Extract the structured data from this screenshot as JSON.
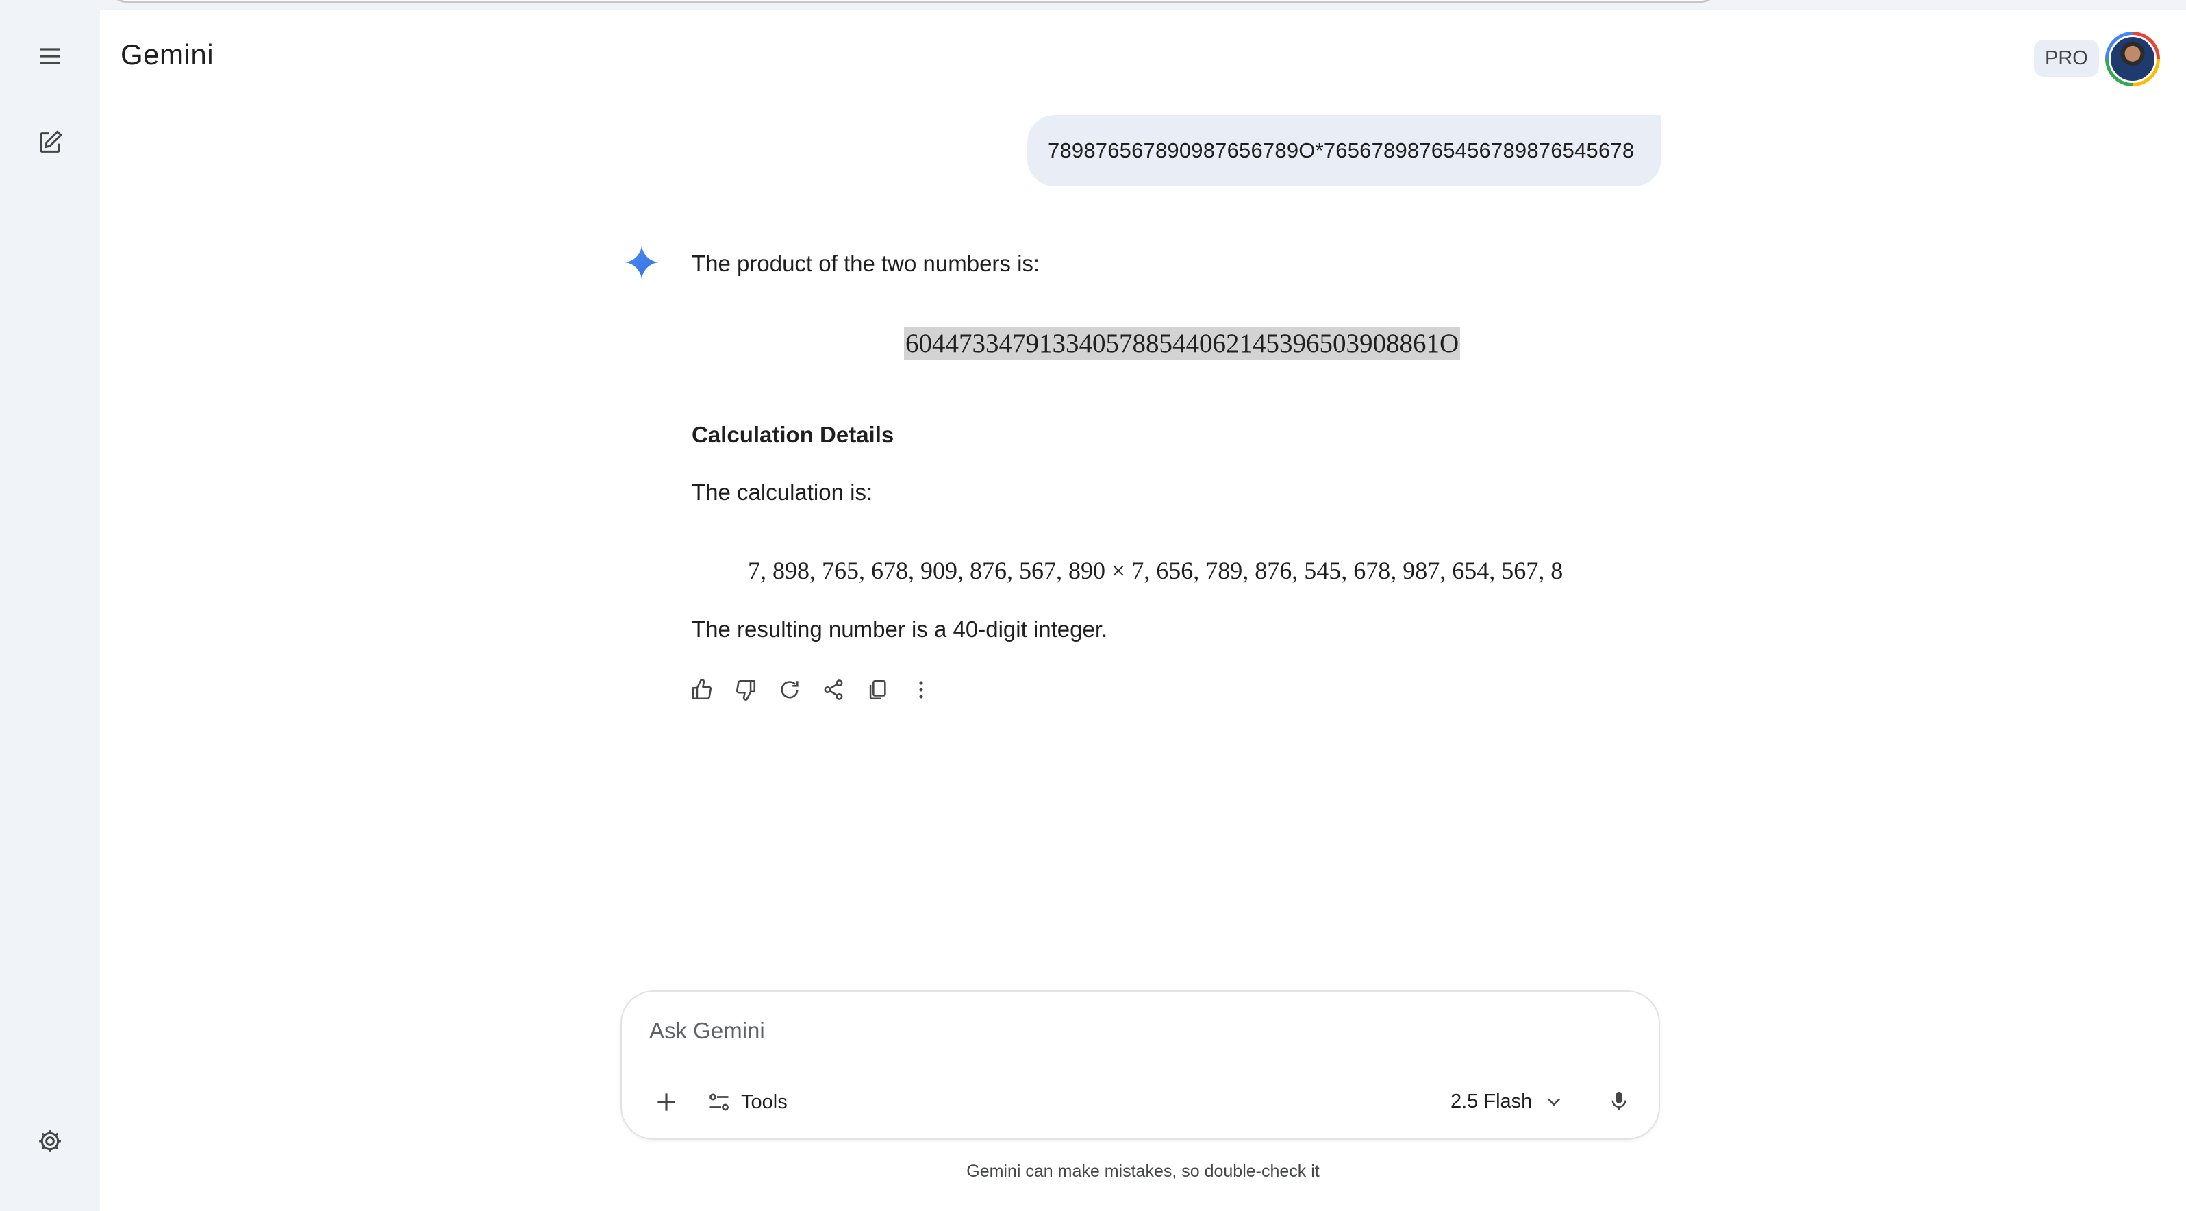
{
  "app": {
    "title": "Gemini",
    "plan_badge": "PRO"
  },
  "sidebar": {
    "menu_icon": "hamburger-menu-icon",
    "new_chat_icon": "edit-icon",
    "settings_icon": "gear-icon"
  },
  "conversation": {
    "user_prompt": "789876567890987656789O*76567898765456789876545678",
    "response": {
      "intro": "The product of the two numbers is:",
      "result": "6044733479133405788544062145396503908861O",
      "section_heading": "Calculation Details",
      "calc_intro": "The calculation is:",
      "calc_expression": "7, 898, 765, 678, 909, 876, 567, 890 × 7, 656, 789, 876, 545, 678, 987, 654, 567, 8",
      "conclusion": "The resulting number is a 40-digit integer."
    },
    "actions": [
      "thumbs-up-icon",
      "thumbs-down-icon",
      "refresh-icon",
      "share-icon",
      "copy-icon",
      "more-vert-icon"
    ]
  },
  "input": {
    "placeholder": "Ask Gemini",
    "tools_label": "Tools",
    "model_label": "2.5 Flash"
  },
  "footer": {
    "disclaimer": "Gemini can make mistakes, so double-check it"
  },
  "colors": {
    "sidebar_bg": "#f0f4f9",
    "bubble_bg": "#e9eef6",
    "sparkle_blue": "#4285f4",
    "highlight": "#d3d3d3"
  }
}
